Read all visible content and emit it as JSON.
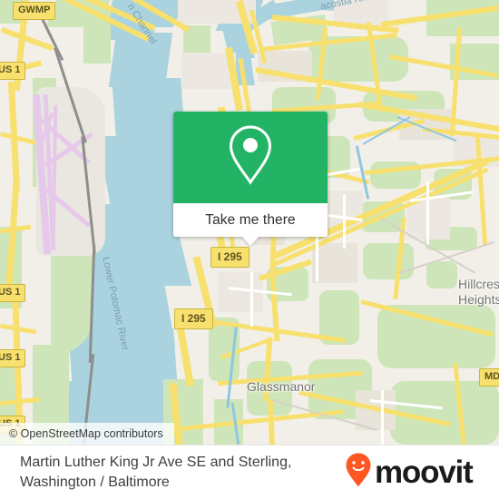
{
  "callout": {
    "icon": "map-pin-icon",
    "button_label": "Take me there",
    "accent_color": "#22b464"
  },
  "map": {
    "attribution": "© OpenStreetMap contributors",
    "base_color": "#f2efe9",
    "water_color": "#aad3df",
    "green_color": "#cde5b8",
    "road_color": "#f7e06e",
    "labels": {
      "water": [
        {
          "text": "n Channel",
          "full": "Washington Channel"
        },
        {
          "text": "acostia River",
          "full": "Anacostia River"
        },
        {
          "text": "Lower Potomac River"
        }
      ],
      "places": [
        {
          "text": "Glassmanor"
        },
        {
          "text": "Hillcrest"
        },
        {
          "text": "Heights"
        }
      ],
      "shields": [
        {
          "text": "GWMP"
        },
        {
          "text": "US 1"
        },
        {
          "text": "US 1"
        },
        {
          "text": "US 1"
        },
        {
          "text": "US 1"
        },
        {
          "text": "I 295"
        },
        {
          "text": "I 295"
        },
        {
          "text": "MD"
        }
      ]
    }
  },
  "footer": {
    "title_line1": "Martin Luther King Jr Ave SE and Sterling,",
    "title_line2": "Washington / Baltimore",
    "brand_name": "moovit",
    "brand_icon": "moovit-pin-icon",
    "brand_color": "#ff5722"
  }
}
